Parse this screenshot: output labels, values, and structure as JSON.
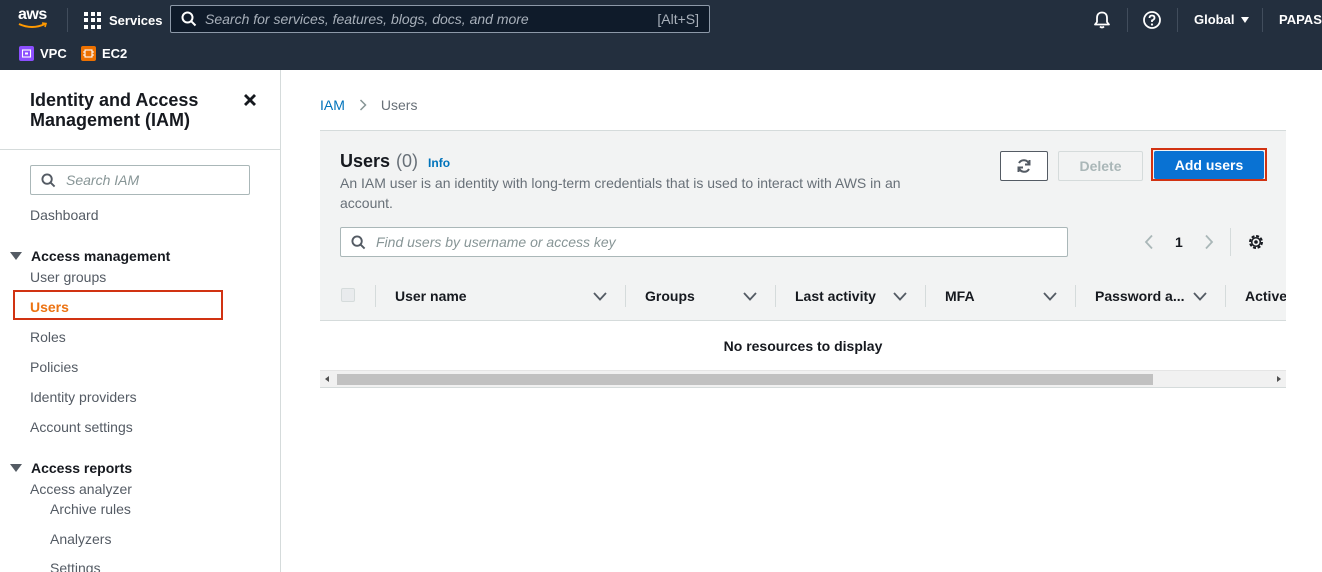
{
  "topnav": {
    "logo_text": "aws",
    "services_label": "Services",
    "search_placeholder": "Search for services, features, blogs, docs, and more",
    "search_shortcut": "[Alt+S]",
    "region_label": "Global",
    "account_label": "PAPASO"
  },
  "favorites": [
    {
      "label": "VPC",
      "color": "#8c4fff"
    },
    {
      "label": "EC2",
      "color": "#ed7100"
    }
  ],
  "sidebar": {
    "title": "Identity and Access Management (IAM)",
    "search_placeholder": "Search IAM",
    "dashboard": "Dashboard",
    "access_management": {
      "label": "Access management",
      "items": [
        "User groups",
        "Users",
        "Roles",
        "Policies",
        "Identity providers",
        "Account settings"
      ],
      "active": "Users"
    },
    "access_reports": {
      "label": "Access reports",
      "items": [
        "Access analyzer"
      ],
      "sub_items": [
        "Archive rules",
        "Analyzers",
        "Settings"
      ]
    }
  },
  "breadcrumb": {
    "root": "IAM",
    "current": "Users"
  },
  "users_panel": {
    "title": "Users",
    "count": "(0)",
    "info": "Info",
    "description": "An IAM user is an identity with long-term credentials that is used to interact with AWS in an account.",
    "delete_label": "Delete",
    "add_label": "Add users",
    "filter_placeholder": "Find users by username or access key",
    "page": "1",
    "columns": [
      "User name",
      "Groups",
      "Last activity",
      "MFA",
      "Password a...",
      "Active"
    ],
    "empty_text": "No resources to display"
  },
  "colors": {
    "nav_bg": "#232f3e",
    "primary": "#0972d3",
    "link": "#0073bb",
    "active_nav": "#ec7211",
    "highlight": "#d13212"
  }
}
